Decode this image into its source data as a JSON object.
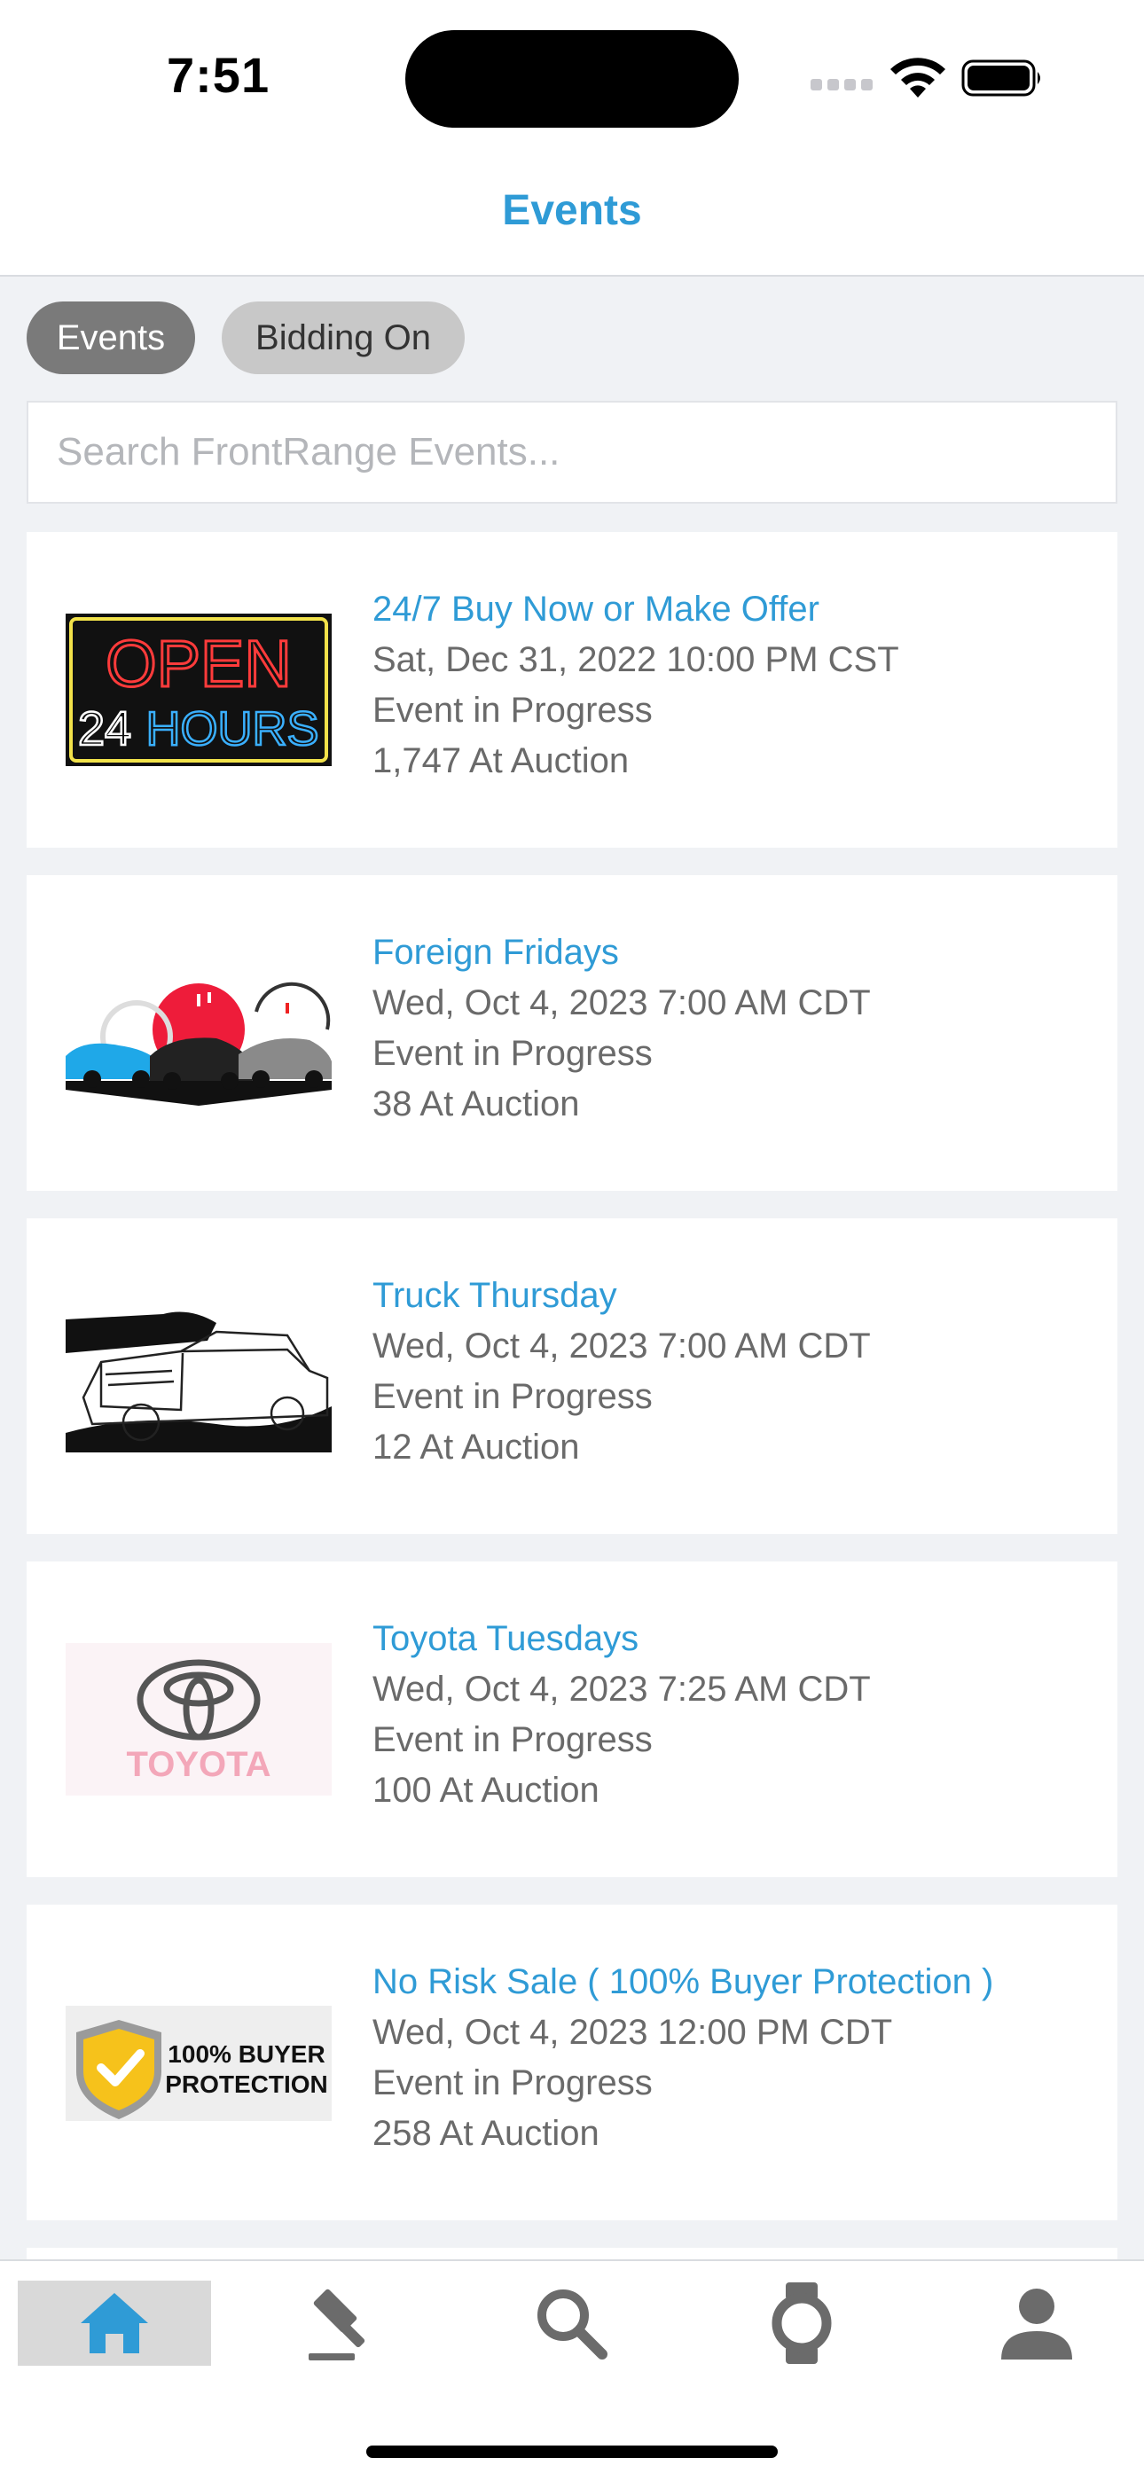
{
  "status": {
    "time": "7:51"
  },
  "header": {
    "title": "Events"
  },
  "segments": {
    "events": "Events",
    "bidding": "Bidding On"
  },
  "search": {
    "placeholder": "Search FrontRange Events..."
  },
  "events": [
    {
      "title": "24/7 Buy Now or Make Offer",
      "date": "Sat, Dec 31, 2022 10:00 PM CST",
      "status": "Event in Progress",
      "count": "1,747 At Auction",
      "thumb_text_1": "OPEN",
      "thumb_text_2a": "24",
      "thumb_text_2b": "HOURS"
    },
    {
      "title": "Foreign Fridays",
      "date": "Wed, Oct 4, 2023 7:00 AM CDT",
      "status": "Event in Progress",
      "count": "38 At Auction"
    },
    {
      "title": "Truck Thursday",
      "date": "Wed, Oct 4, 2023 7:00 AM CDT",
      "status": "Event in Progress",
      "count": "12 At Auction"
    },
    {
      "title": "Toyota Tuesdays",
      "date": "Wed, Oct 4, 2023 7:25 AM CDT",
      "status": "Event in Progress",
      "count": "100 At Auction",
      "thumb_text": "TOYOTA"
    },
    {
      "title": "No Risk Sale ( 100% Buyer Protection )",
      "date": "Wed, Oct 4, 2023 12:00 PM CDT",
      "status": "Event in Progress",
      "count": "258 At Auction",
      "thumb_text_1": "100% BUYER",
      "thumb_text_2": "PROTECTION"
    }
  ],
  "tabbar": {
    "items": [
      {
        "icon": "home-icon",
        "active": true
      },
      {
        "icon": "gavel-icon",
        "active": false
      },
      {
        "icon": "search-icon",
        "active": false
      },
      {
        "icon": "watch-icon",
        "active": false
      },
      {
        "icon": "person-icon",
        "active": false
      }
    ]
  },
  "colors": {
    "accent": "#2f9bd6",
    "active_tab": "#2f9bd6",
    "inactive_tab": "#6b6b6b"
  }
}
